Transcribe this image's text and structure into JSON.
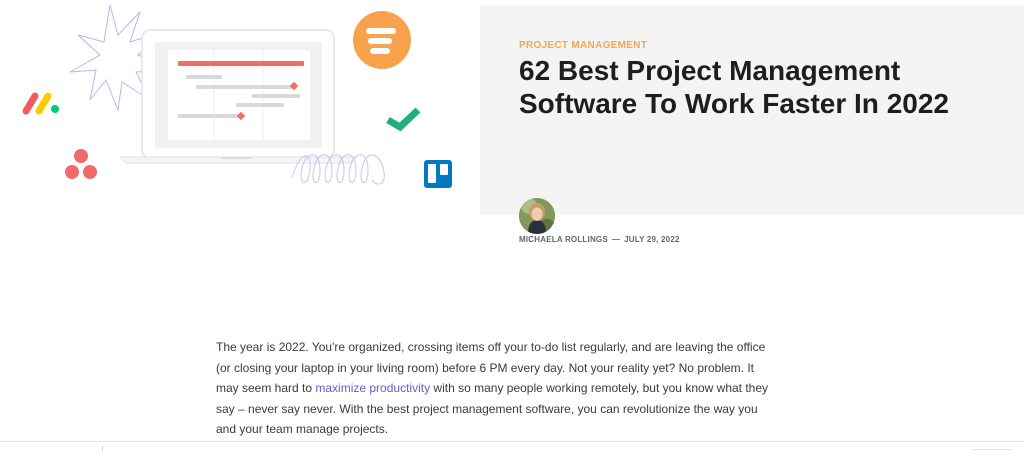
{
  "post": {
    "category": "PROJECT MANAGEMENT",
    "title": "62 Best Project Management Software To Work Faster In 2022",
    "author": "MICHAELA ROLLINGS",
    "separator": "—",
    "date": "JULY 29, 2022"
  },
  "body": {
    "p1_before_link": "The year is 2022. You're organized, crossing items off your to-do list regularly, and are leaving the office (or closing your laptop in your living room) before 6 PM every day. Not your reality yet? No problem. It may seem hard to ",
    "link_text": "maximize productivity",
    "p1_after_link": " with so many people working remotely, but you know what they say – never say never. With the best project management software, you can revolutionize the way you and your team manage projects."
  },
  "colors": {
    "accent": "#f2a65a",
    "link": "#6a5acd",
    "gantt_bar": "#f07060",
    "logo_orange": "#f8a24e",
    "trello_blue": "#0079bf",
    "check_green": "#21b07a",
    "asana_pink": "#f06a6a"
  },
  "icons": [
    "monday-logo-icon",
    "asana-logo-icon",
    "clickup-logo-icon",
    "check-logo-icon",
    "trello-logo-icon",
    "laptop-illustration",
    "sparkle-decoration",
    "swirl-decoration"
  ]
}
